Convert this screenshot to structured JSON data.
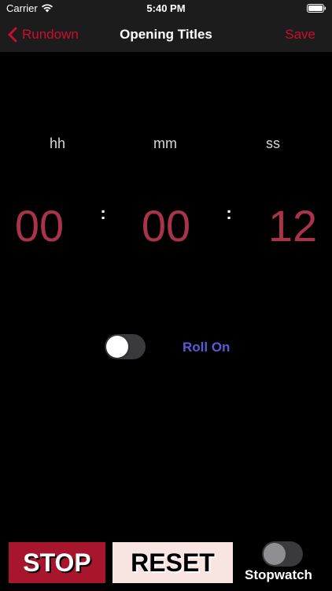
{
  "status_bar": {
    "carrier": "Carrier",
    "time": "5:40 PM",
    "wifi_icon": "wifi-icon",
    "battery_icon": "battery-icon"
  },
  "nav": {
    "back_label": "Rundown",
    "title": "Opening Titles",
    "save_label": "Save",
    "accent_color": "#c8102e"
  },
  "timer": {
    "units": {
      "hh": "hh",
      "mm": "mm",
      "ss": "ss"
    },
    "values": {
      "hh": "00",
      "mm": "00",
      "ss": "12"
    },
    "separator": ":",
    "digit_color": "#a8334a"
  },
  "roll_on": {
    "label": "Roll On",
    "enabled": false,
    "label_color": "#5b5bd6"
  },
  "controls": {
    "stop_label": "STOP",
    "reset_label": "RESET",
    "stopwatch_label": "Stopwatch",
    "stopwatch_enabled": false,
    "stop_color": "#a8162d",
    "reset_color": "#f8e4e0"
  }
}
